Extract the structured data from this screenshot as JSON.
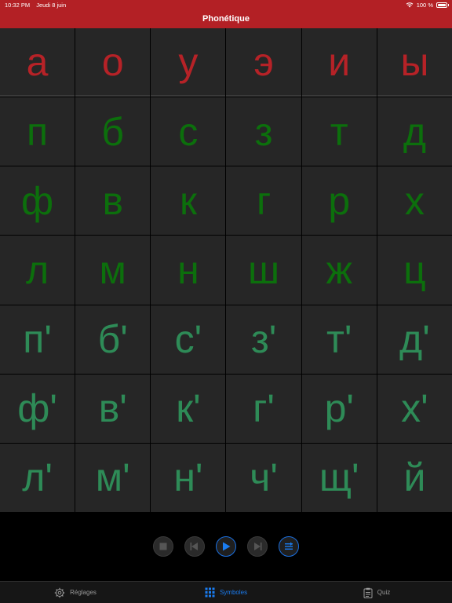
{
  "status": {
    "time": "10:32 PM",
    "date": "Jeudi 8 juin",
    "battery": "100 %"
  },
  "nav": {
    "title": "Phonétique"
  },
  "rows": [
    {
      "kind": "vowel",
      "letters": [
        "а",
        "о",
        "у",
        "э",
        "и",
        "ы"
      ]
    },
    {
      "kind": "hard",
      "letters": [
        "п",
        "б",
        "с",
        "з",
        "т",
        "д"
      ]
    },
    {
      "kind": "hard",
      "letters": [
        "ф",
        "в",
        "к",
        "г",
        "р",
        "х"
      ]
    },
    {
      "kind": "hard",
      "letters": [
        "л",
        "м",
        "н",
        "ш",
        "ж",
        "ц"
      ]
    },
    {
      "kind": "soft",
      "letters": [
        "п'",
        "б'",
        "с'",
        "з'",
        "т'",
        "д'"
      ]
    },
    {
      "kind": "soft",
      "letters": [
        "ф'",
        "в'",
        "к'",
        "г'",
        "р'",
        "х'"
      ]
    },
    {
      "kind": "soft",
      "letters": [
        "л'",
        "м'",
        "н'",
        "ч'",
        "щ'",
        "й"
      ]
    }
  ],
  "controls": [
    "stop-icon",
    "previous-icon",
    "play-icon",
    "next-icon",
    "list-icon"
  ],
  "tabs": [
    {
      "label": "Réglages",
      "icon": "gear-icon"
    },
    {
      "label": "Symboles",
      "icon": "grid-icon",
      "active": true
    },
    {
      "label": "Quiz",
      "icon": "clipboard-icon"
    }
  ],
  "colors": {
    "accent": "#b32025",
    "vowel": "#b62227",
    "hard": "#0c6f0c",
    "soft": "#2e8b57",
    "tab_active": "#1a7cf0"
  }
}
